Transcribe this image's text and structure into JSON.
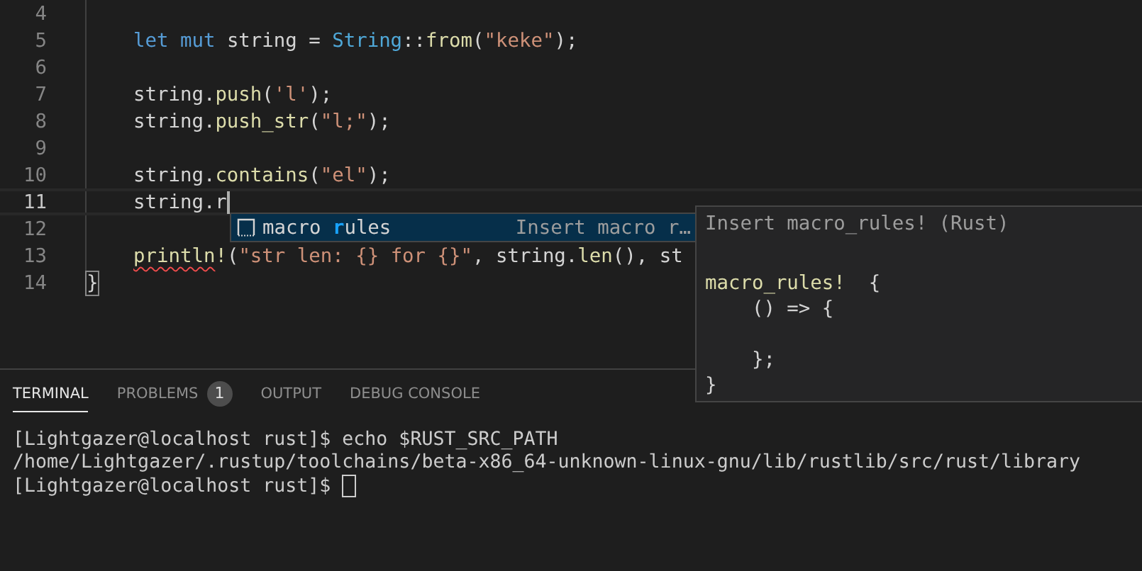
{
  "editor": {
    "lines": [
      {
        "number": "4",
        "current": false
      },
      {
        "number": "5",
        "current": false,
        "indented": true,
        "tokens": [
          {
            "text": "let",
            "kind": "keyword"
          },
          {
            "text": " mut",
            "kind": "keyword"
          },
          {
            "text": " string = ",
            "kind": "plain"
          },
          {
            "text": "String",
            "kind": "type"
          },
          {
            "text": "::",
            "kind": "plain"
          },
          {
            "text": "from",
            "kind": "function"
          },
          {
            "text": "(",
            "kind": "plain"
          },
          {
            "text": "\"keke\"",
            "kind": "string"
          },
          {
            "text": ");",
            "kind": "plain"
          }
        ]
      },
      {
        "number": "6",
        "current": false
      },
      {
        "number": "7",
        "current": false,
        "indented": true,
        "tokens": [
          {
            "text": "string.",
            "kind": "plain"
          },
          {
            "text": "push",
            "kind": "function"
          },
          {
            "text": "(",
            "kind": "plain"
          },
          {
            "text": "'l'",
            "kind": "string"
          },
          {
            "text": ");",
            "kind": "plain"
          }
        ]
      },
      {
        "number": "8",
        "current": false,
        "indented": true,
        "tokens": [
          {
            "text": "string.",
            "kind": "plain"
          },
          {
            "text": "push_str",
            "kind": "function"
          },
          {
            "text": "(",
            "kind": "plain"
          },
          {
            "text": "\"l;\"",
            "kind": "string"
          },
          {
            "text": ");",
            "kind": "plain"
          }
        ]
      },
      {
        "number": "9",
        "current": false
      },
      {
        "number": "10",
        "current": false,
        "indented": true,
        "tokens": [
          {
            "text": "string.",
            "kind": "plain"
          },
          {
            "text": "contains",
            "kind": "function"
          },
          {
            "text": "(",
            "kind": "plain"
          },
          {
            "text": "\"el\"",
            "kind": "string"
          },
          {
            "text": ");",
            "kind": "plain"
          }
        ]
      },
      {
        "number": "11",
        "current": true,
        "indented": true,
        "tokens": [
          {
            "text": "string.r",
            "kind": "plain"
          }
        ]
      },
      {
        "number": "12",
        "current": false
      },
      {
        "number": "13",
        "current": false,
        "indented": true,
        "tokens": [
          {
            "text": "println",
            "kind": "invalid"
          },
          {
            "text": "!",
            "kind": "function"
          },
          {
            "text": "(",
            "kind": "plain"
          },
          {
            "text": "\"str len: {} for {}\"",
            "kind": "string"
          },
          {
            "text": ", string.",
            "kind": "plain"
          },
          {
            "text": "len",
            "kind": "function"
          },
          {
            "text": "(), st",
            "kind": "plain"
          }
        ]
      },
      {
        "number": "14",
        "current": false,
        "indented": false,
        "tokens": [
          {
            "text": "}",
            "kind": "matched"
          }
        ]
      }
    ]
  },
  "suggestions": [
    {
      "selected": true,
      "label": [
        {
          "text": "macro ",
          "match": false
        },
        {
          "text": "r",
          "match": true
        },
        {
          "text": "ules",
          "match": false
        }
      ],
      "detail": "Insert macro r…"
    }
  ],
  "doc": {
    "title": "Insert macro_rules! (Rust)",
    "signature": "macro_rules!",
    "body": "  {\n    () => {\n\n    };\n}"
  },
  "panel": {
    "tabs": [
      {
        "label": "TERMINAL",
        "selected": true
      },
      {
        "label": "PROBLEMS",
        "selected": false,
        "badge": "1"
      },
      {
        "label": "OUTPUT",
        "selected": false
      },
      {
        "label": "DEBUG CONSOLE",
        "selected": false
      }
    ],
    "terminal": {
      "lines": [
        "[Lightgazer@localhost rust]$ echo $RUST_SRC_PATH",
        "/home/Lightgazer/.rustup/toolchains/beta-x86_64-unknown-linux-gnu/lib/rustlib/src/rust/library",
        "[Lightgazer@localhost rust]$ "
      ]
    }
  }
}
